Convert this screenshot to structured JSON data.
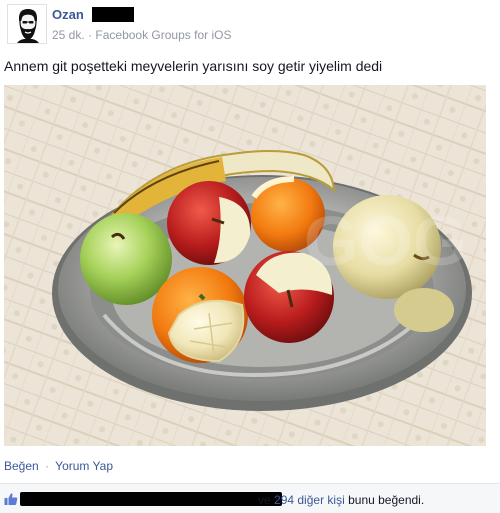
{
  "post": {
    "author": {
      "name": "Ozan",
      "avatar_icon": "bearded-man-avatar-icon"
    },
    "meta": {
      "time": "25 dk.",
      "separator": "·",
      "source": "Facebook Groups for iOS"
    },
    "text": "Annem git poşetteki meyvelerin yarısını soy getir yiyelim dedi",
    "photo": {
      "description_icon": "fruit-bowl-photo",
      "watermark": "GOG"
    }
  },
  "actions": {
    "like": "Beğen",
    "separator": "·",
    "comment": "Yorum Yap"
  },
  "likes": {
    "prefix": "ve",
    "count_text": "294 diğer kişi",
    "suffix": "bunu beğendi."
  },
  "colors": {
    "link": "#3b5998",
    "meta": "#9197a3",
    "text": "#141823",
    "bar": "#f6f7f9"
  }
}
